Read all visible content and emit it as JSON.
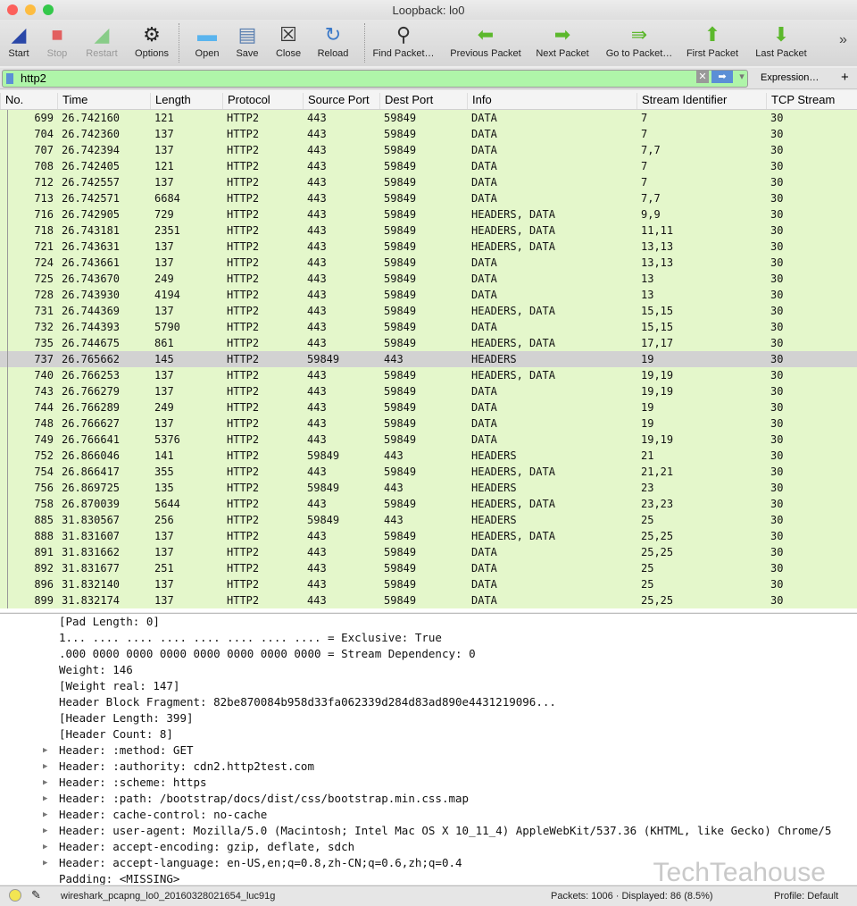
{
  "window": {
    "title": "Loopback: lo0"
  },
  "toolbar": [
    {
      "label": "Start",
      "icon": "shark-fin-icon",
      "enabled": true
    },
    {
      "label": "Stop",
      "icon": "stop-icon",
      "enabled": false
    },
    {
      "label": "Restart",
      "icon": "restart-icon",
      "enabled": false
    },
    {
      "label": "Options",
      "icon": "gear-icon",
      "enabled": true
    },
    {
      "label": "Open",
      "icon": "folder-icon",
      "enabled": true
    },
    {
      "label": "Save",
      "icon": "save-icon",
      "enabled": true
    },
    {
      "label": "Close",
      "icon": "close-file-icon",
      "enabled": true
    },
    {
      "label": "Reload",
      "icon": "reload-icon",
      "enabled": true
    },
    {
      "label": "Find Packet…",
      "icon": "magnifier-icon",
      "enabled": true
    },
    {
      "label": "Previous Packet",
      "icon": "arrow-left-icon",
      "enabled": true
    },
    {
      "label": "Next Packet",
      "icon": "arrow-right-icon",
      "enabled": true
    },
    {
      "label": "Go to Packet…",
      "icon": "goto-icon",
      "enabled": true
    },
    {
      "label": "First Packet",
      "icon": "arrow-up-icon",
      "enabled": true
    },
    {
      "label": "Last Packet",
      "icon": "arrow-down-icon",
      "enabled": true
    }
  ],
  "filter": {
    "value": "http2",
    "expression_label": "Expression…",
    "plus_label": "+",
    "overflow": "»"
  },
  "columns": [
    "No.",
    "Time",
    "Length",
    "Protocol",
    "Source Port",
    "Dest Port",
    "Info",
    "Stream Identifier",
    "TCP Stream"
  ],
  "selected_no": "737",
  "rows": [
    [
      "699",
      "26.742160",
      "121",
      "HTTP2",
      "443",
      "59849",
      "DATA",
      "7",
      "30"
    ],
    [
      "704",
      "26.742360",
      "137",
      "HTTP2",
      "443",
      "59849",
      "DATA",
      "7",
      "30"
    ],
    [
      "707",
      "26.742394",
      "137",
      "HTTP2",
      "443",
      "59849",
      "DATA",
      "7,7",
      "30"
    ],
    [
      "708",
      "26.742405",
      "121",
      "HTTP2",
      "443",
      "59849",
      "DATA",
      "7",
      "30"
    ],
    [
      "712",
      "26.742557",
      "137",
      "HTTP2",
      "443",
      "59849",
      "DATA",
      "7",
      "30"
    ],
    [
      "713",
      "26.742571",
      "6684",
      "HTTP2",
      "443",
      "59849",
      "DATA",
      "7,7",
      "30"
    ],
    [
      "716",
      "26.742905",
      "729",
      "HTTP2",
      "443",
      "59849",
      "HEADERS, DATA",
      "9,9",
      "30"
    ],
    [
      "718",
      "26.743181",
      "2351",
      "HTTP2",
      "443",
      "59849",
      "HEADERS, DATA",
      "11,11",
      "30"
    ],
    [
      "721",
      "26.743631",
      "137",
      "HTTP2",
      "443",
      "59849",
      "HEADERS, DATA",
      "13,13",
      "30"
    ],
    [
      "724",
      "26.743661",
      "137",
      "HTTP2",
      "443",
      "59849",
      "DATA",
      "13,13",
      "30"
    ],
    [
      "725",
      "26.743670",
      "249",
      "HTTP2",
      "443",
      "59849",
      "DATA",
      "13",
      "30"
    ],
    [
      "728",
      "26.743930",
      "4194",
      "HTTP2",
      "443",
      "59849",
      "DATA",
      "13",
      "30"
    ],
    [
      "731",
      "26.744369",
      "137",
      "HTTP2",
      "443",
      "59849",
      "HEADERS, DATA",
      "15,15",
      "30"
    ],
    [
      "732",
      "26.744393",
      "5790",
      "HTTP2",
      "443",
      "59849",
      "DATA",
      "15,15",
      "30"
    ],
    [
      "735",
      "26.744675",
      "861",
      "HTTP2",
      "443",
      "59849",
      "HEADERS, DATA",
      "17,17",
      "30"
    ],
    [
      "737",
      "26.765662",
      "145",
      "HTTP2",
      "59849",
      "443",
      "HEADERS",
      "19",
      "30"
    ],
    [
      "740",
      "26.766253",
      "137",
      "HTTP2",
      "443",
      "59849",
      "HEADERS, DATA",
      "19,19",
      "30"
    ],
    [
      "743",
      "26.766279",
      "137",
      "HTTP2",
      "443",
      "59849",
      "DATA",
      "19,19",
      "30"
    ],
    [
      "744",
      "26.766289",
      "249",
      "HTTP2",
      "443",
      "59849",
      "DATA",
      "19",
      "30"
    ],
    [
      "748",
      "26.766627",
      "137",
      "HTTP2",
      "443",
      "59849",
      "DATA",
      "19",
      "30"
    ],
    [
      "749",
      "26.766641",
      "5376",
      "HTTP2",
      "443",
      "59849",
      "DATA",
      "19,19",
      "30"
    ],
    [
      "752",
      "26.866046",
      "141",
      "HTTP2",
      "59849",
      "443",
      "HEADERS",
      "21",
      "30"
    ],
    [
      "754",
      "26.866417",
      "355",
      "HTTP2",
      "443",
      "59849",
      "HEADERS, DATA",
      "21,21",
      "30"
    ],
    [
      "756",
      "26.869725",
      "135",
      "HTTP2",
      "59849",
      "443",
      "HEADERS",
      "23",
      "30"
    ],
    [
      "758",
      "26.870039",
      "5644",
      "HTTP2",
      "443",
      "59849",
      "HEADERS, DATA",
      "23,23",
      "30"
    ],
    [
      "885",
      "31.830567",
      "256",
      "HTTP2",
      "59849",
      "443",
      "HEADERS",
      "25",
      "30"
    ],
    [
      "888",
      "31.831607",
      "137",
      "HTTP2",
      "443",
      "59849",
      "HEADERS, DATA",
      "25,25",
      "30"
    ],
    [
      "891",
      "31.831662",
      "137",
      "HTTP2",
      "443",
      "59849",
      "DATA",
      "25,25",
      "30"
    ],
    [
      "892",
      "31.831677",
      "251",
      "HTTP2",
      "443",
      "59849",
      "DATA",
      "25",
      "30"
    ],
    [
      "896",
      "31.832140",
      "137",
      "HTTP2",
      "443",
      "59849",
      "DATA",
      "25",
      "30"
    ],
    [
      "899",
      "31.832174",
      "137",
      "HTTP2",
      "443",
      "59849",
      "DATA",
      "25,25",
      "30"
    ]
  ],
  "details": [
    {
      "text": "[Pad Length: 0]",
      "expandable": false
    },
    {
      "text": "1... .... .... .... .... .... .... .... = Exclusive: True",
      "expandable": false
    },
    {
      "text": ".000 0000 0000 0000 0000 0000 0000 0000 = Stream Dependency: 0",
      "expandable": false
    },
    {
      "text": "Weight: 146",
      "expandable": false
    },
    {
      "text": "[Weight real: 147]",
      "expandable": false
    },
    {
      "text": "Header Block Fragment: 82be870084b958d33fa062339d284d83ad890e4431219096...",
      "expandable": false
    },
    {
      "text": "[Header Length: 399]",
      "expandable": false
    },
    {
      "text": "[Header Count: 8]",
      "expandable": false
    },
    {
      "text": "Header: :method: GET",
      "expandable": true
    },
    {
      "text": "Header: :authority: cdn2.http2test.com",
      "expandable": true
    },
    {
      "text": "Header: :scheme: https",
      "expandable": true
    },
    {
      "text": "Header: :path: /bootstrap/docs/dist/css/bootstrap.min.css.map",
      "expandable": true
    },
    {
      "text": "Header: cache-control: no-cache",
      "expandable": true
    },
    {
      "text": "Header: user-agent: Mozilla/5.0 (Macintosh; Intel Mac OS X 10_11_4) AppleWebKit/537.36 (KHTML, like Gecko) Chrome/5",
      "expandable": true
    },
    {
      "text": "Header: accept-encoding: gzip, deflate, sdch",
      "expandable": true
    },
    {
      "text": "Header: accept-language: en-US,en;q=0.8,zh-CN;q=0.6,zh;q=0.4",
      "expandable": true
    },
    {
      "text": "Padding: <MISSING>",
      "expandable": false
    }
  ],
  "watermark": "TechTeahouse",
  "status": {
    "file": "wireshark_pcapng_lo0_20160328021654_luc91g",
    "packets": "Packets: 1006 · Displayed: 86 (8.5%)",
    "profile": "Profile: Default"
  },
  "colors": {
    "row": "#e4f7cb",
    "selected": "#d2d2d2",
    "filter_ok": "#aff5a9"
  }
}
